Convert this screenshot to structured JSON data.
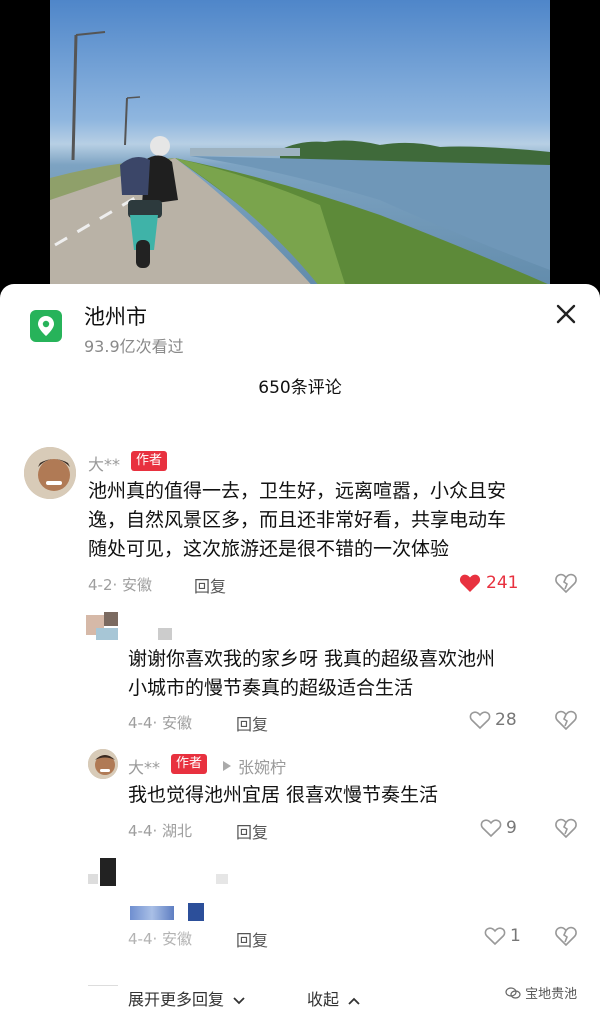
{
  "location": {
    "title": "池州市",
    "views": "93.9亿次看过"
  },
  "comments_header": "650条评论",
  "comments": [
    {
      "username": "大**",
      "badge": "作者",
      "text_lines": [
        "池州真的值得一去，卫生好，远离喧嚣，小众且安",
        "逸，自然风景区多，而且还非常好看，共享电动车",
        "随处可见，这次旅游还是很不错的一次体验"
      ],
      "meta": "4-2· 安徽",
      "reply": "回复",
      "likes": "241"
    },
    {
      "text_lines": [
        "谢谢你喜欢我的家乡呀 我真的超级喜欢池州",
        "小城市的慢节奏真的超级适合生活"
      ],
      "meta": "4-4· 安徽",
      "reply": "回复",
      "likes": "28"
    },
    {
      "username": "大**",
      "badge": "作者",
      "reply_to": "张婉柠",
      "text_lines": [
        "我也觉得池州宜居 很喜欢慢节奏生活"
      ],
      "meta": "4-4· 湖北",
      "reply": "回复",
      "likes": "9"
    },
    {
      "meta": "4-4· 安徽",
      "reply": "回复",
      "likes": "1"
    }
  ],
  "footer": {
    "expand": "展开更多回复",
    "collapse": "收起"
  },
  "watermark": "宝地贵池",
  "colors": {
    "accent_red": "#e8313f",
    "location_green": "#27b35a"
  }
}
